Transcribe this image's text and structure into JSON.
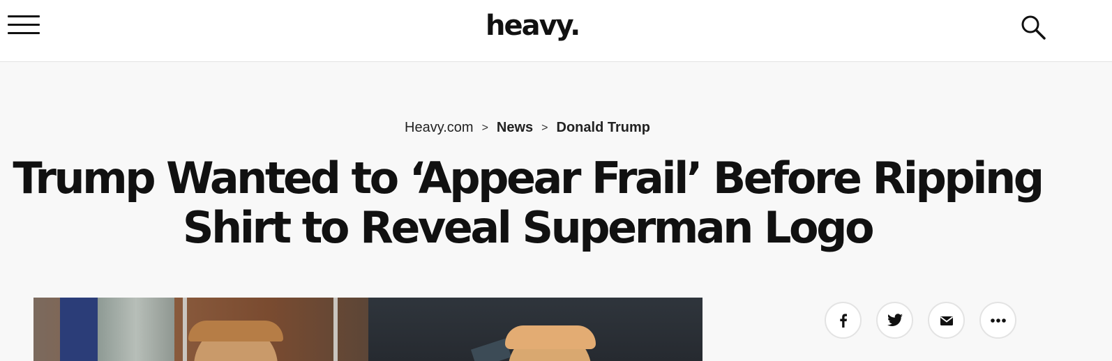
{
  "header": {
    "logo_text": "heavy.",
    "menu_icon": "hamburger-menu-icon",
    "search_icon": "search-icon"
  },
  "breadcrumb": {
    "items": [
      "Heavy.com",
      "News",
      "Donald Trump"
    ],
    "separator": ">"
  },
  "article": {
    "headline_line1": "Trump Wanted to ‘Appear Frail’ Before Ripping",
    "headline_line2": "Shirt to Reveal Superman Logo"
  },
  "share": {
    "buttons": [
      "facebook-icon",
      "twitter-icon",
      "email-icon",
      "more-icon"
    ]
  },
  "colors": {
    "text": "#111111",
    "background": "#f8f8f8",
    "header_bg": "#ffffff"
  }
}
